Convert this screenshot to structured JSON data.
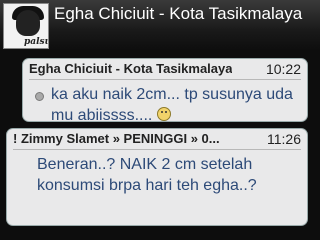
{
  "header": {
    "title": "Egha Chiciuit - Kota Tasikmalaya",
    "avatar_text": "palsu"
  },
  "messages": [
    {
      "sender": "Egha Chiciuit - Kota Tasikmalaya",
      "time": "10:22",
      "text": "ka aku naik 2cm... tp susunya uda mu abiissss....",
      "emoticon": "smiley-icon"
    },
    {
      "sender": "! Zimmy Slamet » PENINGGI » 0...",
      "time": "11:26",
      "text": "Beneran..? NAIK 2 cm setelah konsumsi brpa hari teh egha..?"
    }
  ]
}
